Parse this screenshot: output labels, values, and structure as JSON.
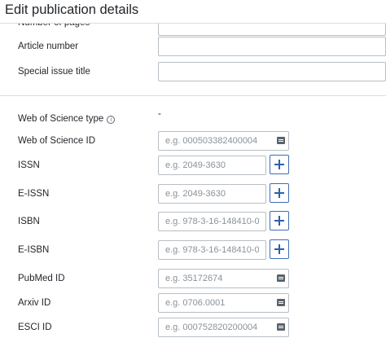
{
  "header": {
    "title": "Edit publication details"
  },
  "fields": {
    "number_of_pages": {
      "label": "Number of pages",
      "value": "",
      "placeholder": ""
    },
    "article_number": {
      "label": "Article number",
      "value": "",
      "placeholder": ""
    },
    "special_issue_title": {
      "label": "Special issue title",
      "value": "",
      "placeholder": ""
    },
    "wos_type": {
      "label": "Web of Science type",
      "info_icon": "info-icon",
      "value": "-"
    },
    "wos_id": {
      "label": "Web of Science ID",
      "placeholder": "e.g. 000503382400004",
      "icon": "id-card-icon"
    },
    "issn": {
      "label": "ISSN",
      "placeholder": "e.g. 2049-3630",
      "add_icon": "plus-icon"
    },
    "eissn": {
      "label": "E-ISSN",
      "placeholder": "e.g. 2049-3630",
      "add_icon": "plus-icon"
    },
    "isbn": {
      "label": "ISBN",
      "placeholder": "e.g. 978-3-16-148410-0",
      "add_icon": "plus-icon"
    },
    "eisbn": {
      "label": "E-ISBN",
      "placeholder": "e.g. 978-3-16-148410-0",
      "add_icon": "plus-icon"
    },
    "pubmed_id": {
      "label": "PubMed ID",
      "placeholder": "e.g. 35172674",
      "icon": "id-card-icon"
    },
    "arxiv_id": {
      "label": "Arxiv ID",
      "placeholder": "e.g. 0706.0001",
      "icon": "id-card-icon"
    },
    "esci_id": {
      "label": "ESCI ID",
      "placeholder": "e.g. 000752820200004",
      "icon": "id-card-icon"
    }
  },
  "colors": {
    "accent": "#2f5fa8",
    "border": "#b7bec6",
    "divider": "#d9dde2",
    "text": "#1f2328"
  }
}
